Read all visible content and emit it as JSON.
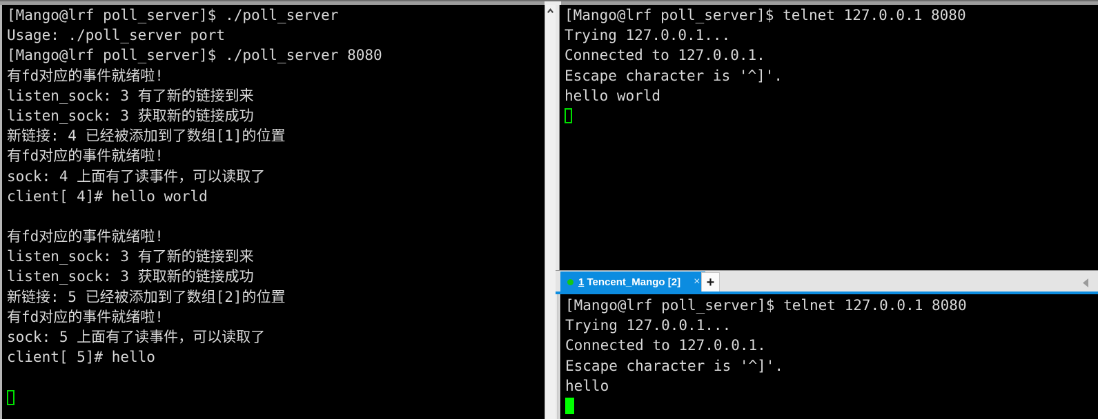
{
  "left_pane": {
    "name": "poll_server output terminal",
    "lines": [
      "[Mango@lrf poll_server]$ ./poll_server",
      "Usage: ./poll_server port",
      "[Mango@lrf poll_server]$ ./poll_server 8080",
      "有fd对应的事件就绪啦!",
      "listen_sock: 3 有了新的链接到来",
      "listen_sock: 3 获取新的链接成功",
      "新链接: 4 已经被添加到了数组[1]的位置",
      "有fd对应的事件就绪啦!",
      "sock: 4 上面有了读事件，可以读取了",
      "client[ 4]# hello world",
      "",
      "有fd对应的事件就绪啦!",
      "listen_sock: 3 有了新的链接到来",
      "listen_sock: 3 获取新的链接成功",
      "新链接: 5 已经被添加到了数组[2]的位置",
      "有fd对应的事件就绪啦!",
      "sock: 5 上面有了读事件，可以读取了",
      "client[ 5]# hello",
      ""
    ],
    "cursor_style": "hollow",
    "cursor_color": "#00e000",
    "scrollbar": {
      "up_arrow_icon": "chevron-up-icon",
      "track_color": "#f0f0f0"
    }
  },
  "right_top_pane": {
    "name": "telnet client terminal 1",
    "lines": [
      "[Mango@lrf poll_server]$ telnet 127.0.0.1 8080",
      "Trying 127.0.0.1...",
      "Connected to 127.0.0.1.",
      "Escape character is '^]'.",
      "hello world"
    ],
    "cursor_style": "hollow",
    "cursor_color": "#00e000"
  },
  "tabbar": {
    "name": "terminal tab bar",
    "accent_color": "#0c8ce0",
    "tabs": [
      {
        "index_accel": "1",
        "title": " Tencent_Mango [2]",
        "full_label": "1 Tencent_Mango [2]",
        "active": true,
        "status_dot_color": "#14c814",
        "close_label": "×"
      }
    ],
    "new_tab_label": "+",
    "scroll_arrow_icon": "triangle-left-icon"
  },
  "right_bottom_pane": {
    "name": "telnet client terminal 2",
    "lines": [
      "[Mango@lrf poll_server]$ telnet 127.0.0.1 8080",
      "Trying 127.0.0.1...",
      "Connected to 127.0.0.1.",
      "Escape character is '^]'.",
      "hello"
    ],
    "cursor_style": "solid",
    "cursor_color": "#00ff00"
  }
}
